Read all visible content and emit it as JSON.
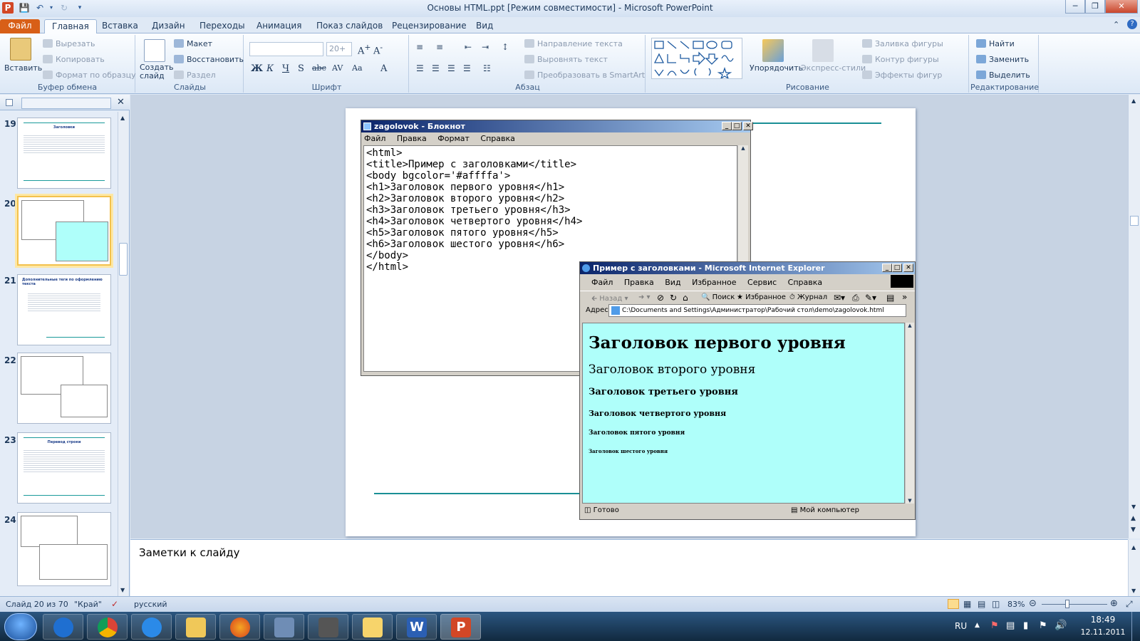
{
  "window": {
    "title": "Основы HTML.ppt [Режим совместимости] - Microsoft PowerPoint"
  },
  "tabs": [
    "Файл",
    "Главная",
    "Вставка",
    "Дизайн",
    "Переходы",
    "Анимация",
    "Показ слайдов",
    "Рецензирование",
    "Вид"
  ],
  "ribbon": {
    "clipboard": {
      "paste": "Вставить",
      "cut": "Вырезать",
      "copy": "Копировать",
      "format_painter": "Формат по образцу",
      "label": "Буфер обмена"
    },
    "slides": {
      "new_slide": "Создать слайд",
      "layout": "Макет",
      "reset": "Восстановить",
      "section": "Раздел",
      "label": "Слайды"
    },
    "font": {
      "size": "20+",
      "label": "Шрифт"
    },
    "paragraph": {
      "text_direction": "Направление текста",
      "align_text": "Выровнять текст",
      "smartart": "Преобразовать в SmartArt",
      "label": "Абзац"
    },
    "drawing": {
      "arrange": "Упорядочить",
      "quick_styles": "Экспресс-стили",
      "fill": "Заливка фигуры",
      "outline": "Контур фигуры",
      "effects": "Эффекты фигур",
      "label": "Рисование"
    },
    "editing": {
      "find": "Найти",
      "replace": "Заменить",
      "select": "Выделить",
      "label": "Редактирование"
    }
  },
  "thumbnails": [
    {
      "num": "19",
      "title": "Заголовки"
    },
    {
      "num": "20",
      "title": ""
    },
    {
      "num": "21",
      "title": "Дополнительные теги по оформлению текста"
    },
    {
      "num": "22",
      "title": ""
    },
    {
      "num": "23",
      "title": "Перевод строки"
    },
    {
      "num": "24",
      "title": ""
    }
  ],
  "notepad": {
    "title": "zagolovok - Блокнот",
    "menu": [
      "Файл",
      "Правка",
      "Формат",
      "Справка"
    ],
    "lines": [
      "<html>",
      "<title>Пример с заголовками</title>",
      "<body bgcolor='#affffa'>",
      "<h1>Заголовок первого уровня</h1>",
      "<h2>Заголовок второго уровня</h2>",
      "<h3>Заголовок третьего уровня</h3>",
      "<h4>Заголовок четвертого уровня</h4>",
      "<h5>Заголовок пятого уровня</h5>",
      "<h6>Заголовок шестого уровня</h6>",
      "</body>",
      "</html>"
    ]
  },
  "ie": {
    "title": "Пример с заголовками - Microsoft Internet Explorer",
    "menu": [
      "Файл",
      "Правка",
      "Вид",
      "Избранное",
      "Сервис",
      "Справка"
    ],
    "back": "Назад",
    "search": "Поиск",
    "favorites": "Избранное",
    "history": "Журнал",
    "address_label": "Адрес",
    "address": "C:\\Documents and Settings\\Администратор\\Рабочий стол\\demo\\zagolovok.html",
    "headings": [
      "Заголовок первого уровня",
      "Заголовок второго уровня",
      "Заголовок третьего уровня",
      "Заголовок четвертого уровня",
      "Заголовок пятого уровня",
      "Заголовок шестого уровня"
    ],
    "status_ready": "Готово",
    "status_zone": "Мой компьютер",
    "page_bg": "#affffa"
  },
  "notes": {
    "placeholder": "Заметки к слайду"
  },
  "status": {
    "slide": "Слайд 20 из 70",
    "theme": "\"Край\"",
    "language": "русский",
    "zoom": "83%"
  },
  "taskbar": {
    "lang": "RU",
    "time": "18:49",
    "date": "12.11.2011"
  }
}
